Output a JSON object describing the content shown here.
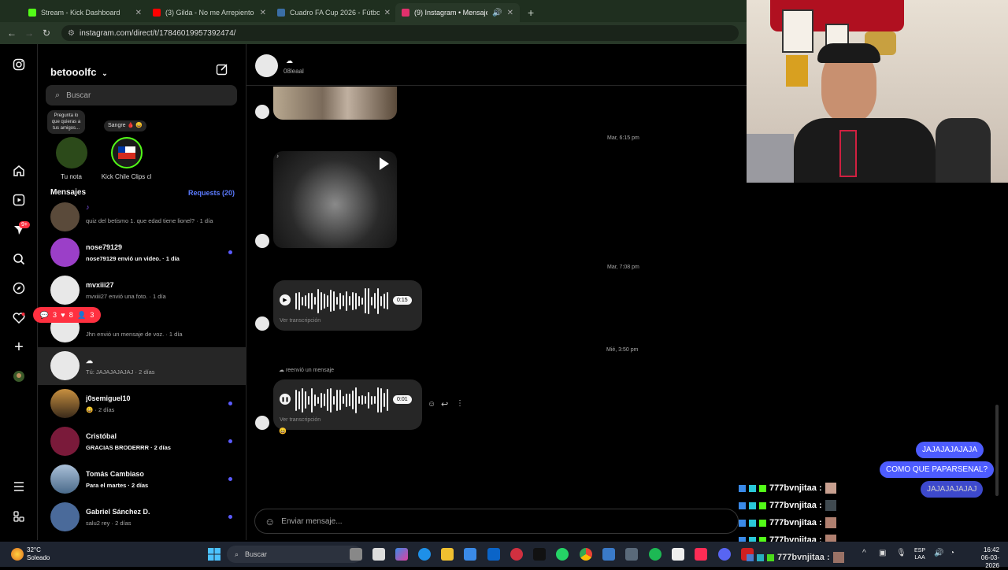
{
  "browser": {
    "tabs": [
      {
        "label": "Stream - Kick Dashboard",
        "color": "#53fc18"
      },
      {
        "label": "(3) Gilda - No me Arrepiento de",
        "color": "#ff0000"
      },
      {
        "label": "Cuadro FA Cup 2026 - Fútbol/Ir",
        "color": "#3a6ea5"
      },
      {
        "label": "(9) Instagram • Mensajes",
        "color": "#e1306c"
      }
    ],
    "url": "instagram.com/direct/t/17846019957392474/"
  },
  "nav": {
    "notif_badge": "9+",
    "icons": [
      "instagram-icon",
      "home-icon",
      "reels-icon",
      "messages-icon",
      "search-icon",
      "explore-icon",
      "heart-icon",
      "create-icon",
      "profile-icon",
      "menu-icon",
      "meta-icon"
    ]
  },
  "inbox": {
    "username": "betooolfc",
    "search_placeholder": "Buscar",
    "note_text": "Pregunta lo que quieras a tus amigos...",
    "note_bubble": "Sangre 🩸 😄",
    "stories": [
      {
        "label": "Tu nota"
      },
      {
        "label": "Kick Chile Clips cl"
      }
    ],
    "mensajes_label": "Mensajes",
    "requests_label": "Requests (20)",
    "conversations": [
      {
        "name": "",
        "preview": "quiz del betismo 1. que edad tiene lionel? · 1 día",
        "unread": false,
        "dot": false,
        "color": "#5a4a3a"
      },
      {
        "name": "nose79129",
        "preview": "nose79129 envió un video. · 1 día",
        "unread": true,
        "dot": true,
        "color": "#9b3fc8"
      },
      {
        "name": "mvxiii27",
        "preview": "mvxiii27 envió una foto. · 1 día",
        "unread": false,
        "dot": false,
        "color": "#e8e8e8"
      },
      {
        "name": "",
        "preview": "Jhn envió un mensaje de voz. · 1 día",
        "unread": false,
        "dot": false,
        "color": "#e8e8e8"
      },
      {
        "name": "☁",
        "preview": "Tú: JAJAJAJAJAJ · 2 días",
        "unread": false,
        "dot": false,
        "color": "#e8e8e8"
      },
      {
        "name": "j0semiguel10",
        "preview": "😄 · 2 días",
        "unread": false,
        "dot": true,
        "color": "#c89040"
      },
      {
        "name": "Cristóbal",
        "preview": "GRACIAS BRODERRR · 2 días",
        "unread": true,
        "dot": true,
        "color": "#7a1a3a"
      },
      {
        "name": "Tomás Cambiaso",
        "preview": "Para el martes · 2 días",
        "unread": true,
        "dot": true,
        "color": "#6a8aa8"
      },
      {
        "name": "Gabriel Sánchez D.",
        "preview": "salu2 rey · 2 días",
        "unread": false,
        "dot": true,
        "color": "#4a6a9a"
      }
    ],
    "activity": {
      "comments": "3",
      "likes": "8",
      "follows": "3"
    }
  },
  "chat": {
    "contact_name": "☁",
    "contact_handle": "08leaal",
    "timestamps": [
      "Mar, 6:15 pm",
      "Mar, 7:08 pm",
      "Mié, 3:50 pm"
    ],
    "audio1_duration": "0:15",
    "audio2_duration": "0:01",
    "transcript_label": "Ver transcripción",
    "forward_label": "reenvió un mensaje",
    "composer_placeholder": "Enviar mensaje..."
  },
  "overlay": {
    "sent_bubbles": [
      "JAJAJAJAJAJA",
      "COMO QUE PAPARSENAL?",
      "JAJAJAJAJAJ"
    ],
    "stream_chat": [
      {
        "user": "777bvnjitaa :"
      },
      {
        "user": "777bvnjitaa :"
      },
      {
        "user": "777bvnjitaa :"
      },
      {
        "user": "777bvnjitaa :"
      },
      {
        "user": "777bvnjitaa :"
      }
    ]
  },
  "taskbar": {
    "weather_temp": "32°C",
    "weather_desc": "Soleado",
    "search_label": "Buscar",
    "lang": "ESP",
    "lang2": "LAA",
    "time": "16:42",
    "date": "06-03-2026"
  }
}
